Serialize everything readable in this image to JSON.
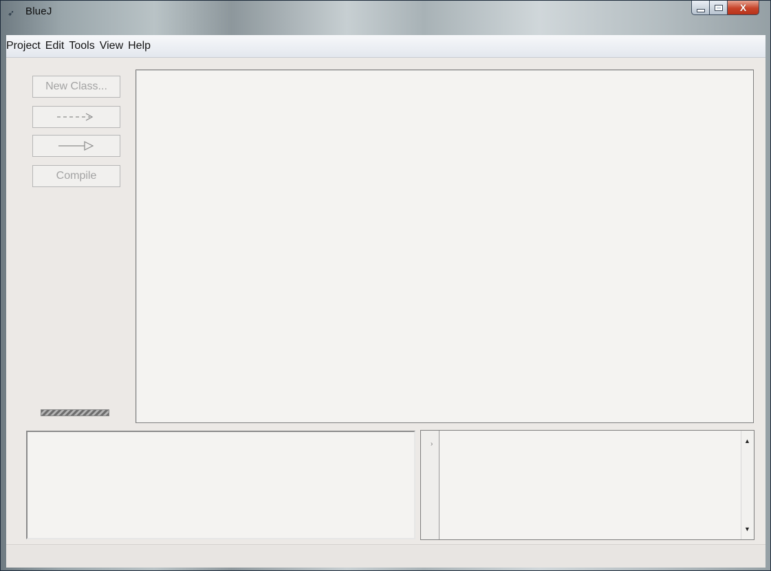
{
  "window": {
    "title": "BlueJ",
    "app_icon": "bluej-bird-icon",
    "controls": {
      "minimize": "minimize-icon",
      "maximize": "maximize-icon",
      "close_label": "X"
    }
  },
  "menubar": {
    "items": [
      "Project",
      "Edit",
      "Tools",
      "View",
      "Help"
    ]
  },
  "toolbar": {
    "new_class_label": "New Class...",
    "uses_arrow_icon": "dashed-uses-arrow-icon",
    "inherit_arrow_icon": "inheritance-arrow-icon",
    "compile_label": "Compile"
  },
  "codepad": {
    "gutter_mark": "›",
    "scroll_up_icon": "▲",
    "scroll_down_icon": "▼"
  },
  "colors": {
    "disabled_text": "#a3a3a3",
    "panel_background": "#f4f3f1",
    "window_background": "#ece9e6",
    "close_button": "#c7442a"
  }
}
